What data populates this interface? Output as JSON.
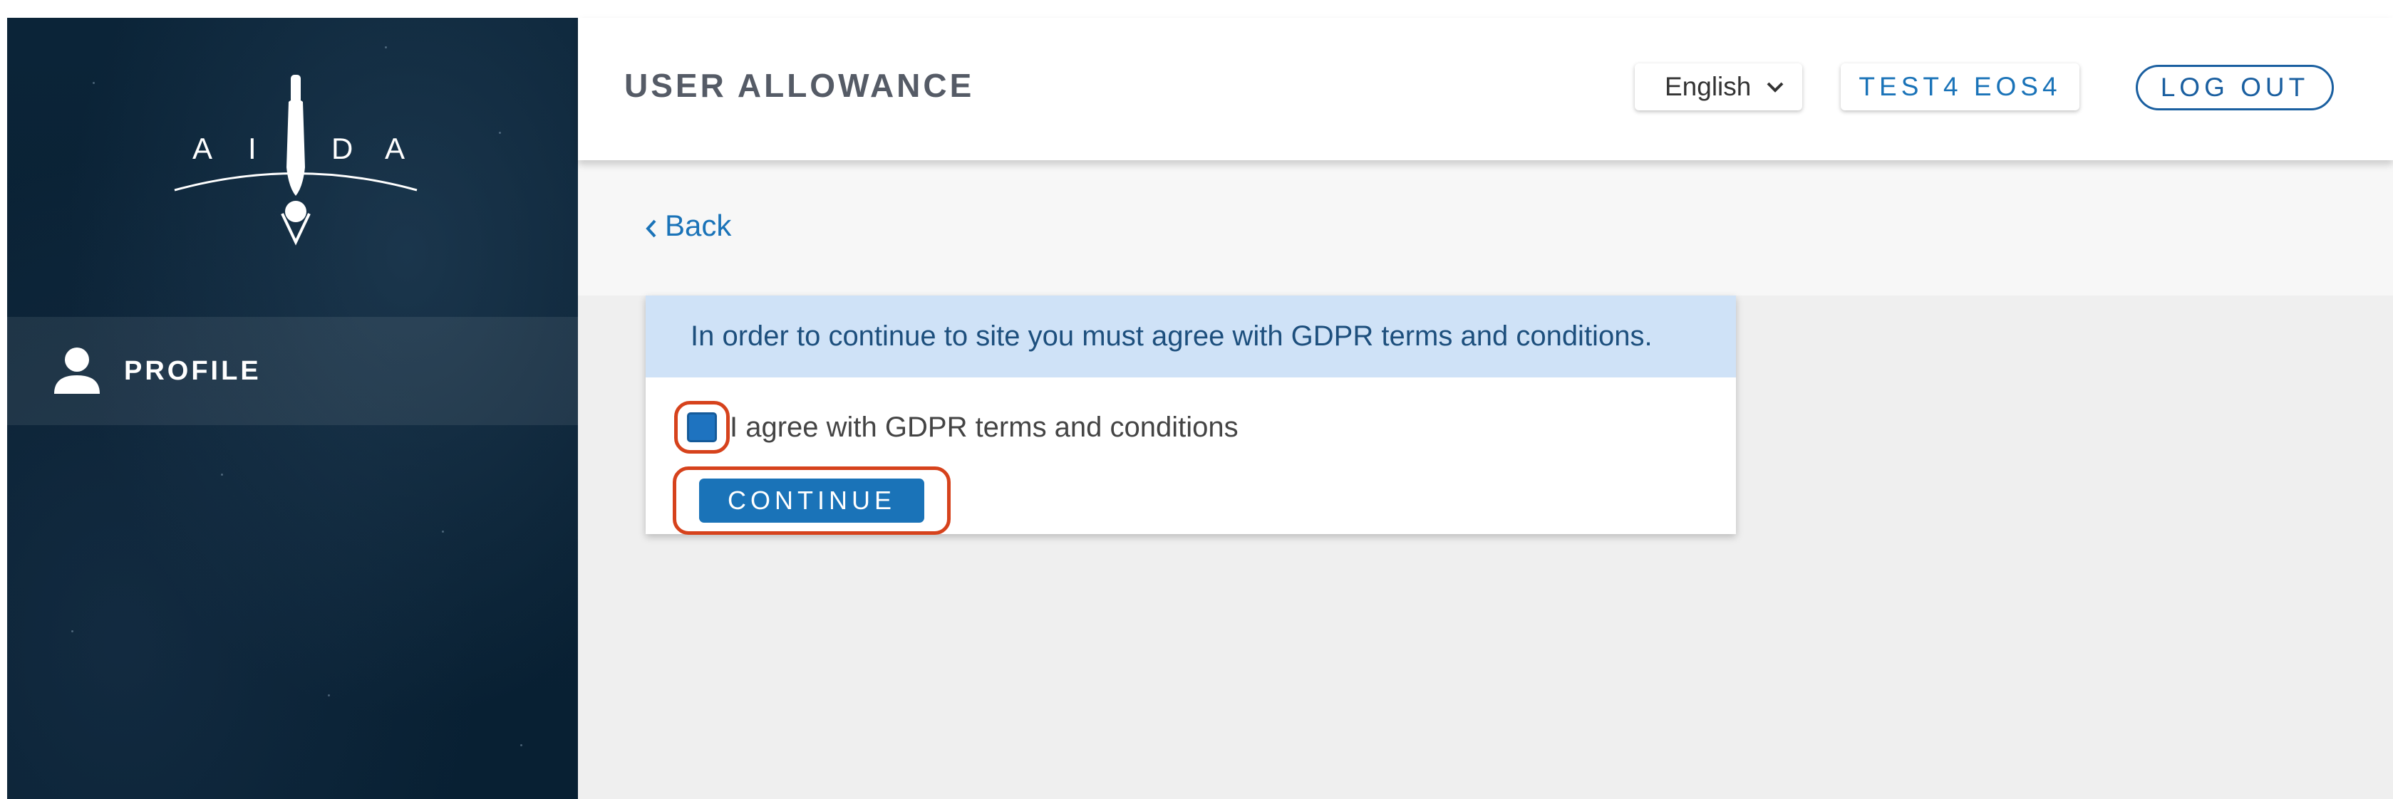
{
  "header": {
    "title": "USER ALLOWANCE",
    "language": {
      "selected": "English"
    },
    "user_label": "TEST4 EOS4",
    "logout_label": "LOG OUT"
  },
  "sidebar": {
    "logo_letters": [
      "A",
      "I",
      "D",
      "A"
    ],
    "items": [
      {
        "label": "PROFILE",
        "icon": "user-icon"
      }
    ]
  },
  "main": {
    "back_label": "Back",
    "gdpr": {
      "message": "In order to continue to site you must agree with GDPR terms and conditions.",
      "checkbox_label": "I agree with GDPR terms and conditions",
      "checked": true,
      "continue_label": "CONTINUE"
    }
  },
  "colors": {
    "sidebar_bg": "#0a2134",
    "accent": "#1a73b8",
    "alert_bg": "#cfe2f7",
    "highlight": "#d6421c"
  }
}
